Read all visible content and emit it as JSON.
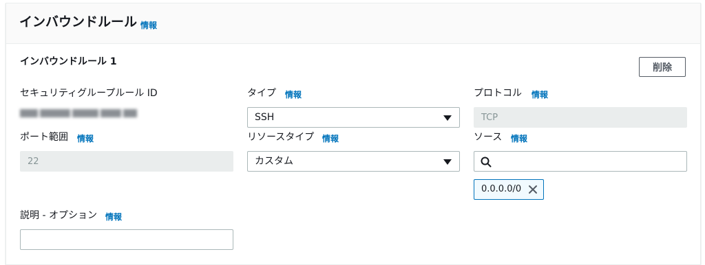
{
  "header": {
    "title": "インバウンドルール",
    "info": "情報"
  },
  "rule": {
    "title": "インバウンドルール 1",
    "delete_label": "削除",
    "sg_rule_id_label": "セキュリティグループルール ID",
    "type_label": "タイプ",
    "type_info": "情報",
    "type_value": "SSH",
    "protocol_label": "プロトコル",
    "protocol_info": "情報",
    "protocol_value": "TCP",
    "port_label": "ポート範囲",
    "port_info": "情報",
    "port_value": "22",
    "source_type_label": "リソースタイプ",
    "source_type_info": "情報",
    "source_type_value": "カスタム",
    "source_label": "ソース",
    "source_info": "情報",
    "source_search_value": "",
    "source_token": "0.0.0.0/0",
    "description_label": "説明 - オプション",
    "description_info": "情報",
    "description_value": ""
  },
  "icons": {
    "search": "search-icon",
    "remove": "close-icon",
    "dropdown": "caret-down-icon"
  },
  "colors": {
    "link": "#0073bb",
    "token_border": "#0073bb",
    "disabled_bg": "#eaeded"
  }
}
